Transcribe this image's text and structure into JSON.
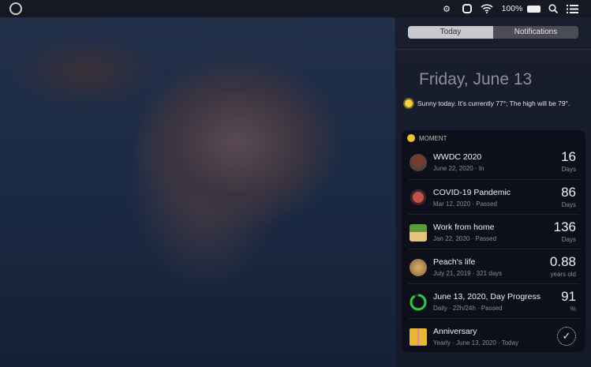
{
  "menubar": {
    "battery": "100%",
    "icons": [
      "app-logo-icon",
      "gear-icon",
      "notes-icon",
      "wifi-icon",
      "battery-icon",
      "search-icon",
      "notification-center-icon"
    ]
  },
  "panel": {
    "tabs": [
      {
        "label": "Today",
        "active": true
      },
      {
        "label": "Notifications",
        "active": false
      }
    ],
    "date": "Friday, June 13",
    "weather": "Sunny today. It's currently 77°; The high will be 79°.",
    "widget": {
      "title": "MOMENT",
      "items": [
        {
          "title": "WWDC 2020",
          "subtitle": "June 22, 2020 · In",
          "value": "16",
          "unit": "Days"
        },
        {
          "title": "COVID-19 Pandemic",
          "subtitle": "Mar 12, 2020  · Passed",
          "value": "86",
          "unit": "Days"
        },
        {
          "title": "Work from home",
          "subtitle": "Jan 22, 2020 · Passed",
          "value": "136",
          "unit": "Days"
        },
        {
          "title": "Peach's life",
          "subtitle": "July 21, 2019 · 321 days",
          "value": "0.88",
          "unit": "years old"
        },
        {
          "title": "June 13, 2020, Day Progress",
          "subtitle": "Daily · 22h/24h · Passed",
          "value": "91",
          "unit": "%",
          "progress": 0.91
        },
        {
          "title": "Anniversary",
          "subtitle": "Yearly · June 13, 2020 · Today",
          "value": "✓"
        }
      ]
    }
  }
}
